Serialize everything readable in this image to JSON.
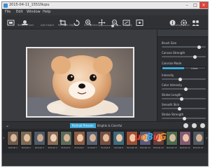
{
  "window": {
    "title": "2015-04-11_1551Nupu"
  },
  "menu": [
    "File",
    "Edit",
    "Window",
    "Help"
  ],
  "toolbar": {
    "before_after_label": "Before / Over",
    "add_object_label": "Add Object",
    "remove_object_label": "Remove Object",
    "detail_strength_label": "Detail Strength",
    "apply_label": "Apply",
    "settings_label": "Drawings Panel"
  },
  "panel": {
    "header": "",
    "controls": [
      {
        "label": "Brush Size",
        "value": 0.88
      },
      {
        "label": "Canvas Strength",
        "value": 0.78
      },
      {
        "label": "Colorize Mode",
        "toggle": true,
        "off_label": "Linea"
      },
      {
        "label": "Intensity",
        "value": 0.42
      },
      {
        "label": "Color Intensity",
        "value": 0.55
      },
      {
        "label": "Stroke Length",
        "value": 0.45
      },
      {
        "label": "Smooth Skin",
        "value": 0.4
      },
      {
        "label": "Stroke Strength",
        "value": 0.52
      }
    ]
  },
  "strip": {
    "tabs": [
      "Portrait Presets",
      "Brights & Colorful"
    ],
    "thumbs": [
      "Portrait 1",
      "Portrait 2",
      "Portrait 3",
      "Portrait 4",
      "Portrait 5",
      "Portrait 6",
      "Portrait 7",
      "Portrait 8",
      "Portrait 9",
      "Portrait 10",
      "Portrait 11",
      "Portrait 12",
      "Portrait 13",
      "Portrait 14",
      "Portrait 15"
    ]
  },
  "watermark": {
    "text": "uoBuG",
    "sub": ".com"
  },
  "colors": {
    "accent": "#3aa8d8",
    "bg": "#3a3c40",
    "panel": "#2b2d31"
  }
}
